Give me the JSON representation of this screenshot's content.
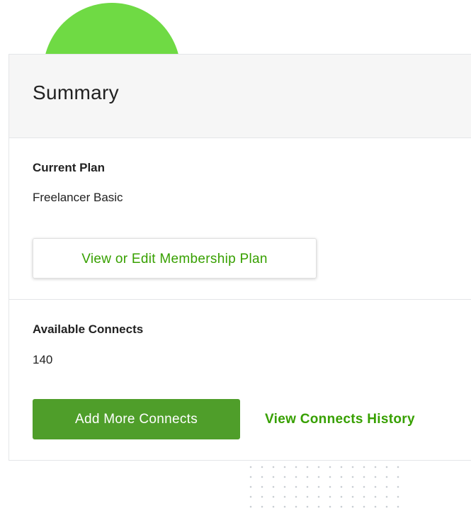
{
  "summary": {
    "title": "Summary"
  },
  "plan": {
    "label": "Current Plan",
    "value": "Freelancer Basic",
    "edit_button": "View or Edit Membership Plan"
  },
  "connects": {
    "label": "Available Connects",
    "value": "140",
    "add_button": "Add More Connects",
    "history_link": "View Connects History"
  },
  "colors": {
    "brand_green": "#37a000",
    "button_green": "#4f9e2a",
    "decor_circle": "#6fda44",
    "header_bg": "#f6f6f6"
  }
}
